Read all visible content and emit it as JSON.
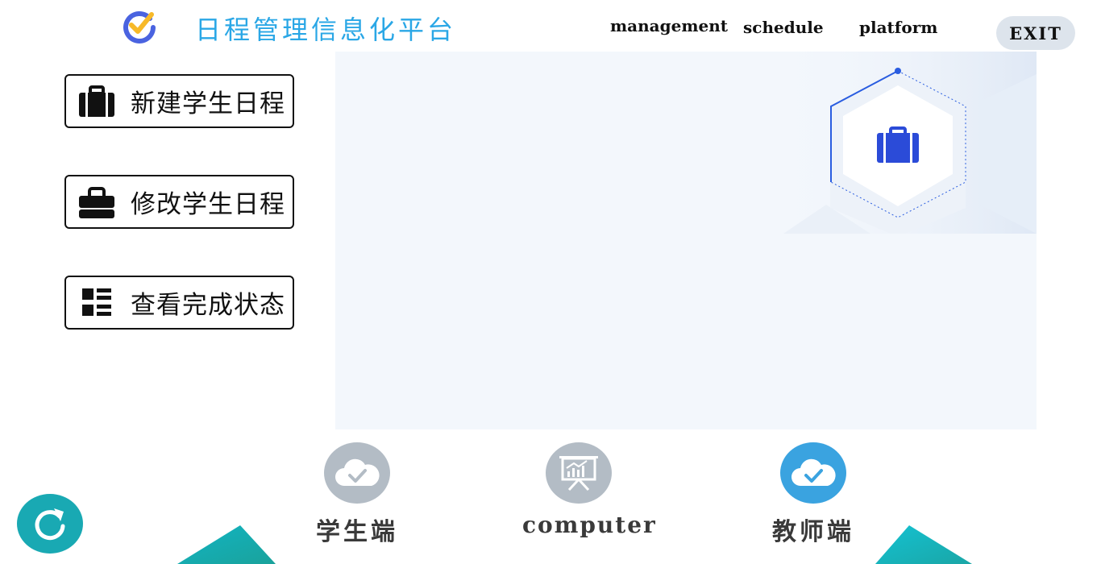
{
  "header": {
    "title": "日程管理信息化平台",
    "nav": {
      "management": "management",
      "schedule": "schedule",
      "platform": "platform"
    },
    "exit_label": "EXIT"
  },
  "actions": [
    {
      "label": "新建学生日程",
      "icon": "briefcase-icon"
    },
    {
      "label": "修改学生日程",
      "icon": "bag-icon"
    },
    {
      "label": "查看完成状态",
      "icon": "list-icon"
    }
  ],
  "roles": [
    {
      "label": "学生端",
      "icon": "cloud-check-icon"
    },
    {
      "label": "computer",
      "icon": "presentation-chart-icon"
    },
    {
      "label": "教师端",
      "icon": "cloud-check-icon"
    }
  ],
  "colors": {
    "title": "#2aa7e6",
    "panel": "#f3f7fc",
    "role_inactive": "#b3bcc5",
    "role_active": "#3aa3e0",
    "refresh": "#19a9b3",
    "accent_blue": "#2b4bd8"
  }
}
